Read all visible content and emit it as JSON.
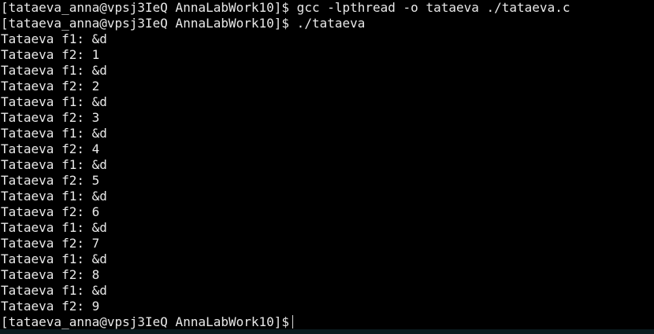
{
  "terminal": {
    "background": "#000000",
    "foreground": "#e8e8e8",
    "lines": [
      "[tataeva_anna@vpsj3IeQ AnnaLabWork10]$ gcc -lpthread -o tataeva ./tataeva.c",
      "[tataeva_anna@vpsj3IeQ AnnaLabWork10]$ ./tataeva",
      "Tataeva f1: &d",
      "Tataeva f2: 1",
      "Tataeva f1: &d",
      "Tataeva f2: 2",
      "Tataeva f1: &d",
      "Tataeva f2: 3",
      "Tataeva f1: &d",
      "Tataeva f2: 4",
      "Tataeva f1: &d",
      "Tataeva f2: 5",
      "Tataeva f1: &d",
      "Tataeva f2: 6",
      "Tataeva f1: &d",
      "Tataeva f2: 7",
      "Tataeva f1: &d",
      "Tataeva f2: 8",
      "Tataeva f1: &d",
      "Tataeva f2: 9"
    ],
    "prompt": "[tataeva_anna@vpsj3IeQ AnnaLabWork10]$"
  }
}
